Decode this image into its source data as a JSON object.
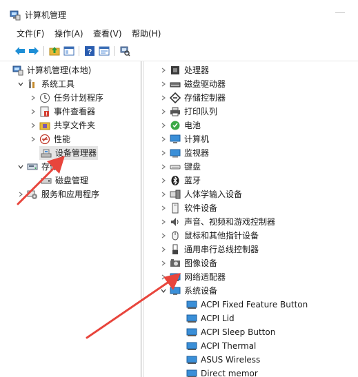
{
  "window": {
    "title": "计算机管理"
  },
  "menu": {
    "file": "文件(F)",
    "action": "操作(A)",
    "view": "查看(V)",
    "help": "帮助(H)"
  },
  "toolbar": {
    "buttons": [
      "back-arrow-icon",
      "forward-arrow-icon",
      "up-folder-icon",
      "show-hide-tree-icon",
      "help-icon",
      "properties-icon",
      "scan-hardware-icon"
    ]
  },
  "tree": {
    "root": "计算机管理(本地)",
    "system_tools": "系统工具",
    "task_scheduler": "任务计划程序",
    "event_viewer": "事件查看器",
    "shared_folders": "共享文件夹",
    "performance": "性能",
    "device_manager": "设备管理器",
    "storage": "存储",
    "disk_management": "磁盘管理",
    "services_apps": "服务和应用程序"
  },
  "devices": {
    "categories": [
      "处理器",
      "磁盘驱动器",
      "存储控制器",
      "打印队列",
      "电池",
      "计算机",
      "监视器",
      "键盘",
      "蓝牙",
      "人体学输入设备",
      "软件设备",
      "声音、视频和游戏控制器",
      "鼠标和其他指针设备",
      "通用串行总线控制器",
      "图像设备",
      "网络适配器",
      "系统设备"
    ],
    "system_devices": [
      "ACPI Fixed Feature Button",
      "ACPI Lid",
      "ACPI Sleep Button",
      "ACPI Thermal",
      "ASUS Wireless",
      "Direct memor"
    ]
  },
  "colors": {
    "arrow": "#e8453c",
    "selection": "#e5e5e5",
    "monitor_blue": "#3a8fd8"
  }
}
